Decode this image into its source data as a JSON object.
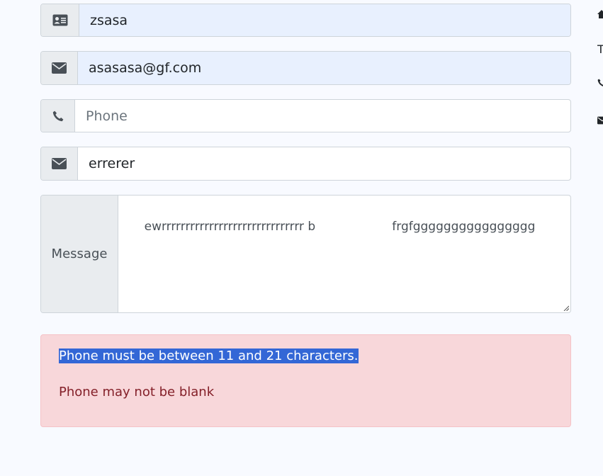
{
  "form": {
    "name_value": "zsasa",
    "email_value": "asasasa@gf.com",
    "phone_placeholder": "Phone",
    "subject_value": "errerer",
    "message_label": "Message",
    "message_value": "ewrrrrrrrrrrrrrrrrrrrrrrrrrrrrrr b                    frgfgggggggggggggggg"
  },
  "alert": {
    "errors": [
      "Phone must be between 11 and 21 characters.",
      "Phone may not be blank"
    ]
  },
  "right_edge": {
    "text_fragment": "T"
  },
  "icons": {
    "name": "id-card-icon",
    "email": "envelope-icon",
    "phone": "phone-icon",
    "subject": "envelope-icon"
  }
}
